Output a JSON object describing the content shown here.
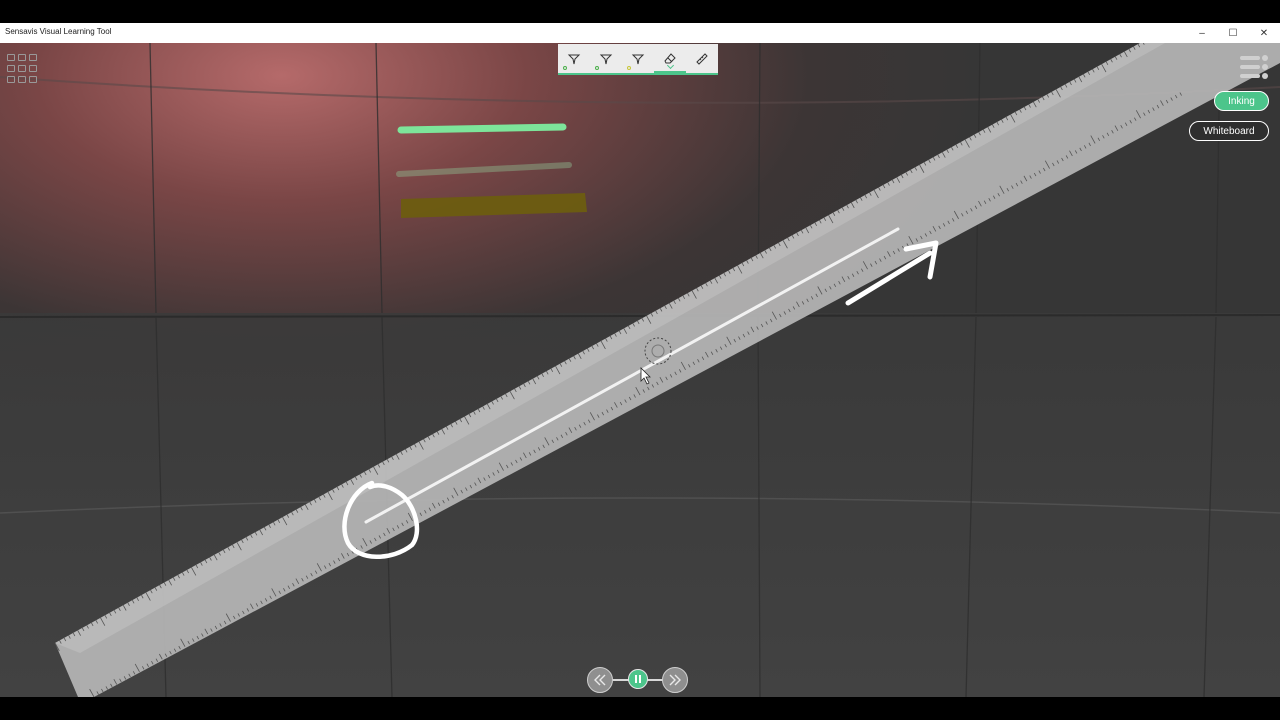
{
  "window": {
    "title": "Sensavis Visual Learning Tool",
    "controls": {
      "minimize": "–",
      "maximize": "☐",
      "close": "✕"
    }
  },
  "toolbar": {
    "tools": [
      {
        "name": "pen-tool-1",
        "icon": "pen-icon",
        "dot_color": "#4bb04b"
      },
      {
        "name": "pen-tool-2",
        "icon": "pen-icon",
        "dot_color": "#4bb04b"
      },
      {
        "name": "pen-tool-3",
        "icon": "pen-icon",
        "dot_color": "#c7c73a"
      },
      {
        "name": "eraser-tool",
        "icon": "eraser-icon",
        "selected": true
      },
      {
        "name": "ruler-tool",
        "icon": "ruler-icon"
      }
    ]
  },
  "mode_buttons": {
    "inking_label": "Inking",
    "whiteboard_label": "Whiteboard"
  },
  "colors": {
    "accent": "#4cc58b",
    "stroke_green": "#7de59a",
    "stroke_yellow": "#6d5d10",
    "ink_white": "#ffffff",
    "ruler": "#b5b5b5"
  }
}
